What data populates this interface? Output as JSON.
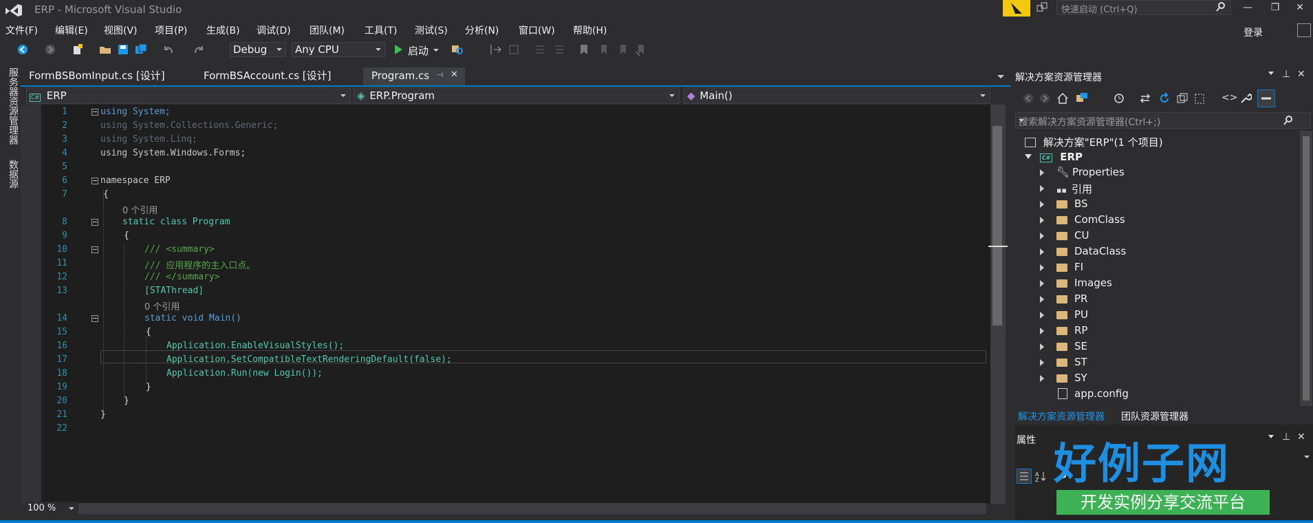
{
  "window": {
    "title": "ERP - Microsoft Visual Studio",
    "quick_launch_placeholder": "快速启动 (Ctrl+Q)",
    "login": "登录"
  },
  "menu": [
    "文件(F)",
    "编辑(E)",
    "视图(V)",
    "项目(P)",
    "生成(B)",
    "调试(D)",
    "团队(M)",
    "工具(T)",
    "测试(S)",
    "分析(N)",
    "窗口(W)",
    "帮助(H)"
  ],
  "toolbar": {
    "configuration": "Debug",
    "platform": "Any CPU",
    "start_label": "启动"
  },
  "left_tabs": [
    "服务器资源管理器",
    "数据源"
  ],
  "doc_tabs": [
    {
      "label": "FormBSBomInput.cs [设计]",
      "active": false
    },
    {
      "label": "FormBSAccount.cs [设计]",
      "active": false
    },
    {
      "label": "Program.cs",
      "active": true
    }
  ],
  "nav": {
    "project": "ERP",
    "class": "ERP.Program",
    "member": "Main()"
  },
  "code_lines": [
    "using System;",
    "using System.Collections.Generic;",
    "using System.Linq;",
    "using System.Windows.Forms;",
    "",
    "namespace ERP",
    "{",
    "static class Program",
    "{",
    "/// <summary>",
    "/// 应用程序的主入口点。",
    "/// </summary>",
    "[STAThread]",
    "static void Main()",
    "{",
    "Application.EnableVisualStyles();",
    "Application.SetCompatibleTextRenderingDefault(false);",
    "Application.Run(new Login());",
    "}",
    "}",
    "}",
    ""
  ],
  "line_numbers": [
    "1",
    "2",
    "3",
    "4",
    "5",
    "6",
    "7",
    "8",
    "9",
    "10",
    "11",
    "12",
    "13",
    "14",
    "15",
    "16",
    "17",
    "18",
    "19",
    "20",
    "21",
    "22"
  ],
  "ref_label": "0 个引用",
  "zoom": "100 %",
  "solution_explorer": {
    "title": "解决方案资源管理器",
    "search_placeholder": "搜索解决方案资源管理器(Ctrl+;)",
    "solution": "解决方案\"ERP\"(1 个项目)",
    "project": "ERP",
    "items": [
      "Properties",
      "引用",
      "BS",
      "ComClass",
      "CU",
      "DataClass",
      "FI",
      "Images",
      "PR",
      "PU",
      "RP",
      "SE",
      "ST",
      "SY",
      "app.config"
    ],
    "bottom_tabs": [
      "解决方案资源管理器",
      "团队资源管理器"
    ]
  },
  "properties": {
    "title": "属性"
  },
  "watermark": {
    "title": "好例子网",
    "subtitle": "开发实例分享交流平台"
  }
}
